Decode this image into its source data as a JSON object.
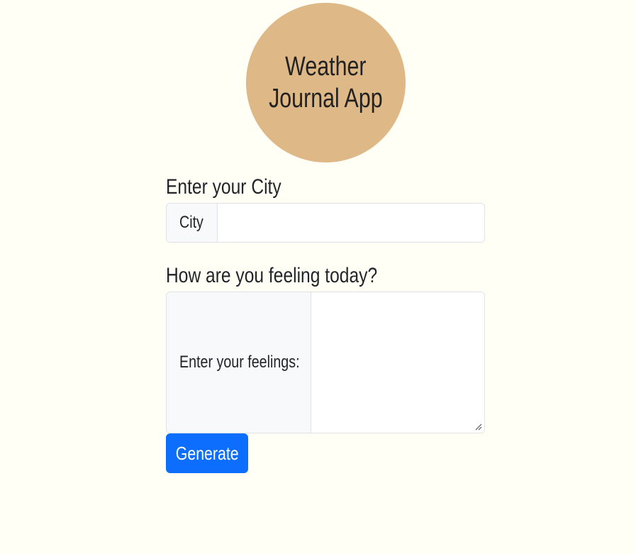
{
  "header": {
    "title_line1": "Weather",
    "title_line2": "Journal App"
  },
  "city": {
    "heading": "Enter your City",
    "addon_label": "City",
    "value": "",
    "placeholder": ""
  },
  "feelings": {
    "heading": "How are you feeling today?",
    "addon_label": "Enter your feelings:",
    "value": "",
    "placeholder": ""
  },
  "actions": {
    "generate_label": "Generate"
  },
  "colors": {
    "background": "#fffff6",
    "logo_circle": "#deb887",
    "primary_button": "#0d6efd"
  }
}
